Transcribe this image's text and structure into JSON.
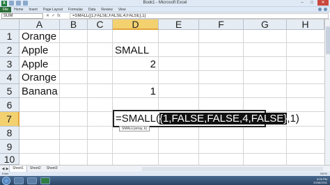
{
  "window": {
    "title": "Book1 - Microsoft Excel",
    "logo": "X",
    "min": "–",
    "max": "□",
    "close": "✕"
  },
  "ribbon": {
    "file": "File",
    "tabs": [
      "Home",
      "Insert",
      "Page Layout",
      "Formulas",
      "Data",
      "Review",
      "View"
    ]
  },
  "formula_bar": {
    "name_box": "SUM",
    "cancel": "✕",
    "enter": "✓",
    "fx": "fx",
    "content": "=SMALL({1,FALSE,FALSE,4,FALSE},1)"
  },
  "columns": [
    "A",
    "B",
    "C",
    "D",
    "E",
    "F",
    "G",
    "H"
  ],
  "rows": [
    "1",
    "2",
    "3",
    "4",
    "5",
    "6",
    "7",
    "8",
    "9",
    "10"
  ],
  "cells": {
    "A1": "Orange",
    "A2": "Apple",
    "A3": "Apple",
    "A4": "Orange",
    "A5": "Banana",
    "D2": "SMALL",
    "D3": "2",
    "D5": "1"
  },
  "edit_cell": {
    "prefix": "=SMALL(",
    "highlight": "{1,FALSE,FALSE,4,FALSE}",
    "suffix": ",1)"
  },
  "tooltip": "SMALL(array, k)",
  "sheets": [
    "Sheet1",
    "Sheet2",
    "Sheet3"
  ],
  "status": {
    "mode": "Enter",
    "zoom": "200%"
  },
  "clock": {
    "time": "5:05 PM",
    "date": "20/06/2011"
  }
}
